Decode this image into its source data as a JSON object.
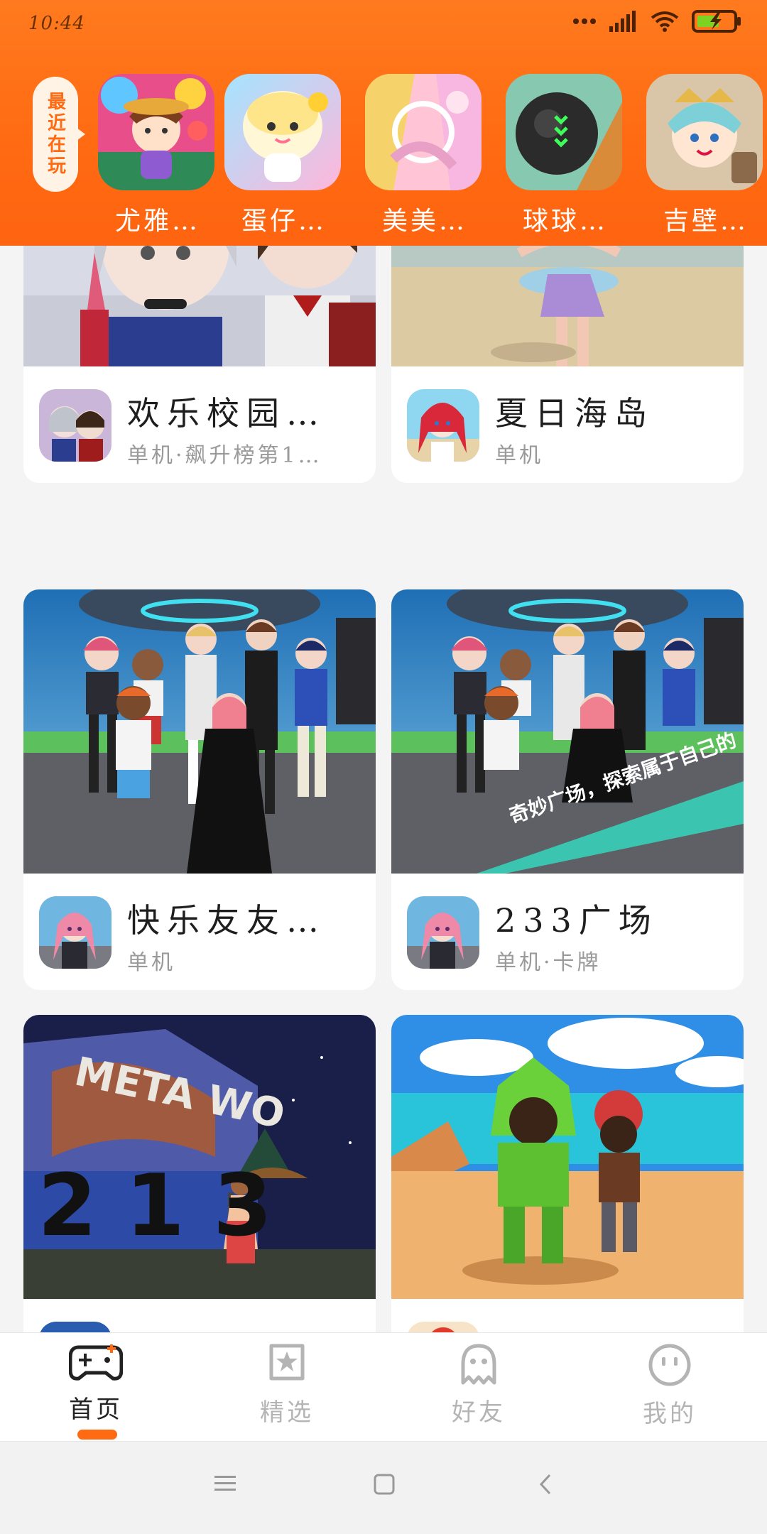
{
  "status_bar": {
    "time": "10:44"
  },
  "recent": {
    "tag_label": "最近在玩",
    "games": [
      {
        "label": "尤雅…"
      },
      {
        "label": "蛋仔…"
      },
      {
        "label": "美美…"
      },
      {
        "label": "球球…"
      },
      {
        "label": "吉壁…"
      }
    ]
  },
  "feed": {
    "cards": [
      {
        "title": "欢乐校园…",
        "subtitle": "单机·飙升榜第1…"
      },
      {
        "title": "夏日海岛",
        "subtitle": "单机"
      },
      {
        "title": "快乐友友…",
        "subtitle": "单机"
      },
      {
        "title": "233广场",
        "subtitle": "单机·卡牌",
        "banner_text": "奇妙广场，探索属于自己的"
      },
      {
        "title": "",
        "subtitle": "",
        "scene_text": "META WO",
        "scene_number": "213"
      },
      {
        "title": "",
        "subtitle": ""
      }
    ]
  },
  "tabbar": {
    "tabs": [
      {
        "label": "首页",
        "icon": "gamepad-icon",
        "active": true
      },
      {
        "label": "精选",
        "icon": "star-bookmark-icon",
        "active": false
      },
      {
        "label": "好友",
        "icon": "ghost-icon",
        "active": false
      },
      {
        "label": "我的",
        "icon": "smiley-icon",
        "active": false
      }
    ]
  },
  "colors": {
    "accent": "#ff6a12",
    "header": "#ff7a1e"
  }
}
